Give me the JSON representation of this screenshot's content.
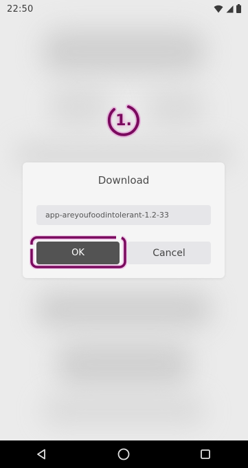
{
  "status_bar": {
    "time": "22:50",
    "icons": [
      "wifi-icon",
      "cell-signal-icon",
      "battery-icon"
    ]
  },
  "step_marker": {
    "number": "1.",
    "color": "#7a0a5e"
  },
  "dialog": {
    "title": "Download",
    "file_name": "app-areyoufoodintolerant-1.2-33",
    "ok_label": "OK",
    "cancel_label": "Cancel"
  },
  "nav_bar": {
    "icons": [
      "back-icon",
      "home-icon",
      "recents-icon"
    ]
  },
  "colors": {
    "highlight": "#7a0a5e",
    "highlight_glow": "#e040c0",
    "ok_button": "#535353",
    "nav_bar": "#000000"
  }
}
